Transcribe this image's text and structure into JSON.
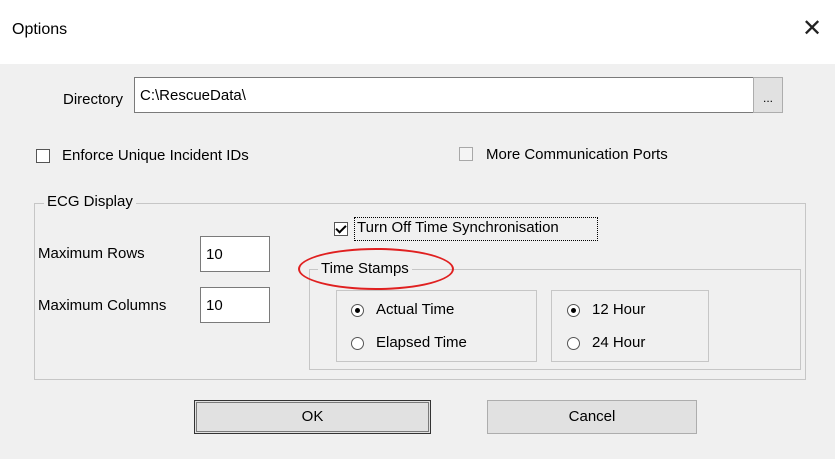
{
  "dialog": {
    "title": "Options",
    "close_glyph": "✕"
  },
  "directory": {
    "label": "Directory",
    "value": "C:\\RescueData\\",
    "browse_label": "..."
  },
  "options": {
    "enforce_unique": {
      "label": "Enforce Unique Incident IDs",
      "checked": false
    },
    "more_ports": {
      "label": "More Communication Ports",
      "checked": false,
      "enabled": false
    }
  },
  "ecg": {
    "legend": "ECG Display",
    "max_rows_label": "Maximum Rows",
    "max_rows_value": "10",
    "max_cols_label": "Maximum Columns",
    "max_cols_value": "10",
    "turn_off_sync": {
      "label": "Turn Off Time Synchronisation",
      "checked": true
    },
    "time_stamps": {
      "legend": "Time Stamps",
      "mode_options": [
        {
          "label": "Actual Time",
          "selected": true
        },
        {
          "label": "Elapsed Time",
          "selected": false
        }
      ],
      "format_options": [
        {
          "label": "12 Hour",
          "selected": true
        },
        {
          "label": "24 Hour",
          "selected": false
        }
      ]
    }
  },
  "buttons": {
    "ok": "OK",
    "cancel": "Cancel"
  },
  "colors": {
    "annotation": "#e02020",
    "dialog_bg": "#f0f0f0"
  }
}
